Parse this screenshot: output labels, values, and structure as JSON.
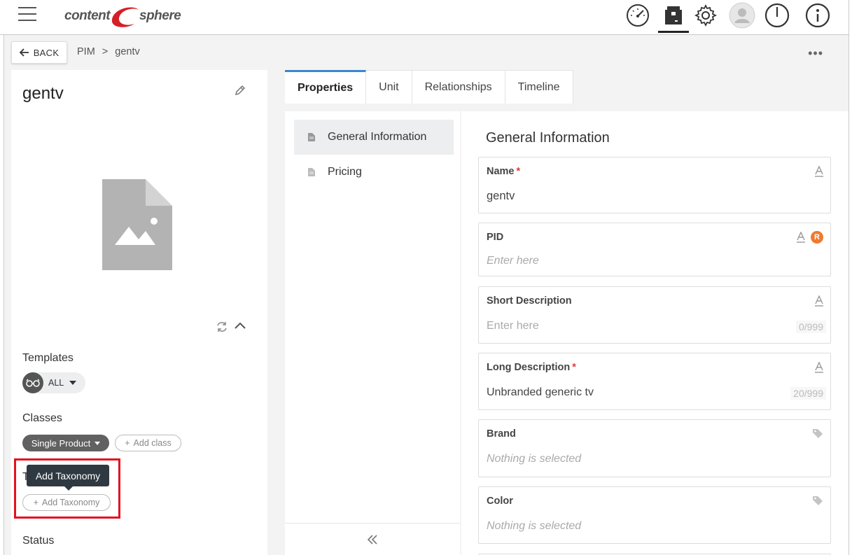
{
  "brand": {
    "left": "content",
    "right": "sphere"
  },
  "topbar": {
    "icons": [
      "dashboard-icon",
      "product-box-icon",
      "gear-icon",
      "user-avatar-icon",
      "power-icon",
      "info-icon"
    ]
  },
  "subbar": {
    "back_label": "BACK",
    "breadcrumb": [
      "PIM",
      ">",
      "gentv"
    ],
    "more": "•••"
  },
  "left": {
    "title": "gentv",
    "templates_label": "Templates",
    "templates_value": "ALL",
    "classes_label": "Classes",
    "class_chip": "Single Product",
    "add_class": "Add class",
    "tooltip": "Add Taxonomy",
    "taxonomy_label_partial": "T",
    "add_taxonomy": "Add Taxonomy",
    "status_label": "Status"
  },
  "tabs": [
    "Properties",
    "Unit",
    "Relationships",
    "Timeline"
  ],
  "subnav": [
    "General Information",
    "Pricing"
  ],
  "form": {
    "title": "General Information",
    "fields": [
      {
        "label": "Name",
        "required": true,
        "value": "gentv"
      },
      {
        "label": "PID",
        "required": false,
        "placeholder": "Enter here",
        "badge": "R"
      },
      {
        "label": "Short Description",
        "required": false,
        "placeholder": "Enter here",
        "counter": "0/999"
      },
      {
        "label": "Long Description",
        "required": true,
        "value": "Unbranded generic tv",
        "counter": "20/999"
      },
      {
        "label": "Brand",
        "required": false,
        "placeholder": "Nothing is selected"
      },
      {
        "label": "Color",
        "required": false,
        "placeholder": "Nothing is selected"
      }
    ]
  },
  "colors": {
    "accent": "#3a86d4",
    "highlight": "#e3101e",
    "badge": "#ef7a30",
    "logo_red": "#d51f26"
  }
}
